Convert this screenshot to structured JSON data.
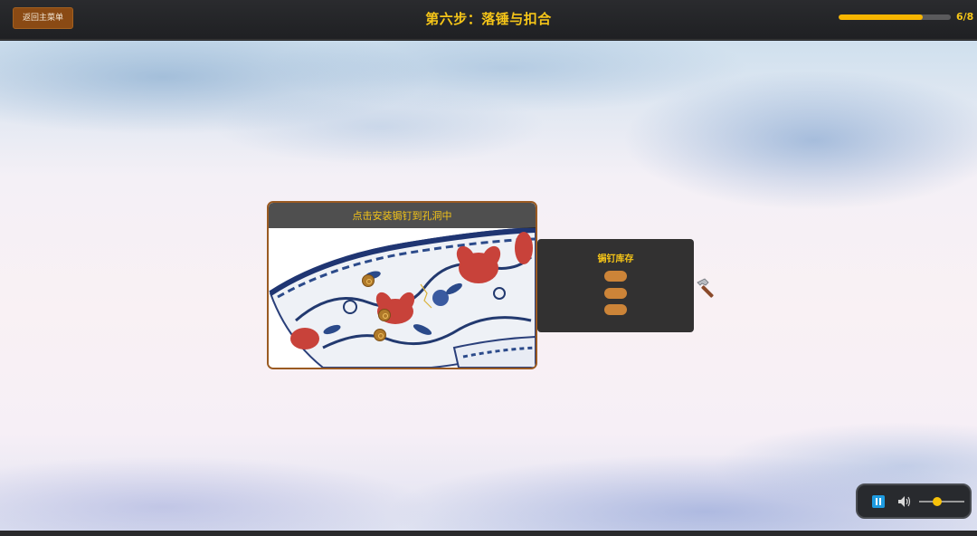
{
  "header": {
    "back_label": "返回主菜单",
    "title": "第六步：落锤与扣合",
    "progress": {
      "current": 6,
      "total": 8,
      "text": "6/8"
    }
  },
  "vase_panel": {
    "instruction": "点击安装锔钉到孔洞中",
    "rivet_holes": 3
  },
  "inventory": {
    "title": "锔钉库存",
    "rivet_count": 3
  },
  "tool": {
    "icon": "hammer-icon"
  },
  "audio": {
    "state": "playing",
    "volume": 0.4
  },
  "colors": {
    "accent": "#f5c518",
    "button_brown": "#8a4a14",
    "rivet": "#cc8438",
    "panel_dark": "#323131"
  }
}
